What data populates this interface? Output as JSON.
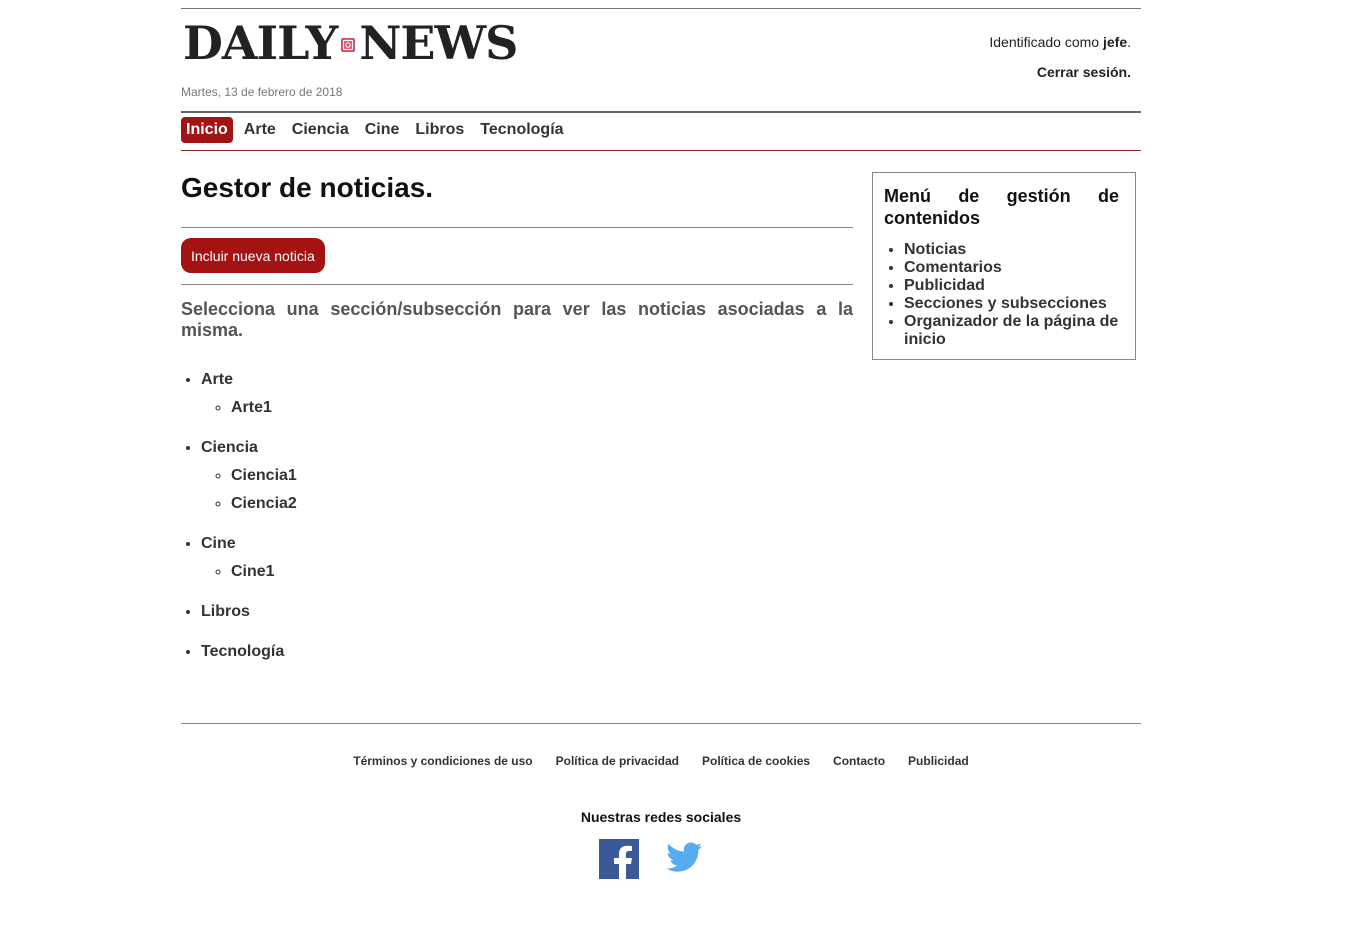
{
  "header": {
    "logo_left": "DAILY",
    "logo_right": "NEWS",
    "date": "Martes, 13 de febrero de 2018",
    "user_prefix": "Identificado como ",
    "user_name": "jefe",
    "user_suffix": ".",
    "logout": "Cerrar sesión."
  },
  "nav": {
    "items": [
      {
        "label": "Inicio",
        "active": true
      },
      {
        "label": "Arte"
      },
      {
        "label": "Ciencia"
      },
      {
        "label": "Cine"
      },
      {
        "label": "Libros"
      },
      {
        "label": "Tecnología"
      }
    ]
  },
  "main": {
    "title": "Gestor de noticias.",
    "new_button": "Incluir nueva noticia",
    "intro": "Selecciona una sección/subsección para ver las noticias asociadas a la misma.",
    "sections": [
      {
        "label": "Arte",
        "subs": [
          "Arte1"
        ]
      },
      {
        "label": "Ciencia",
        "subs": [
          "Ciencia1",
          "Ciencia2"
        ]
      },
      {
        "label": "Cine",
        "subs": [
          "Cine1"
        ]
      },
      {
        "label": "Libros",
        "subs": []
      },
      {
        "label": "Tecnología",
        "subs": []
      }
    ]
  },
  "sidebar": {
    "title_words": [
      "Menú",
      "de",
      "gestión",
      "de"
    ],
    "title_rest": "contenidos",
    "items": [
      "Noticias",
      "Comentarios",
      "Publicidad",
      "Secciones y subsecciones",
      "Organizador de la página de inicio"
    ]
  },
  "footer": {
    "links": [
      "Términos y condiciones de uso",
      "Política de privacidad",
      "Política de cookies",
      "Contacto",
      "Publicidad"
    ],
    "social_title": "Nuestras redes sociales",
    "social": [
      {
        "icon": "facebook-icon",
        "color": "#3b5998"
      },
      {
        "icon": "twitter-icon",
        "color": "#55acee"
      }
    ]
  },
  "colors": {
    "accent": "#a31313"
  }
}
